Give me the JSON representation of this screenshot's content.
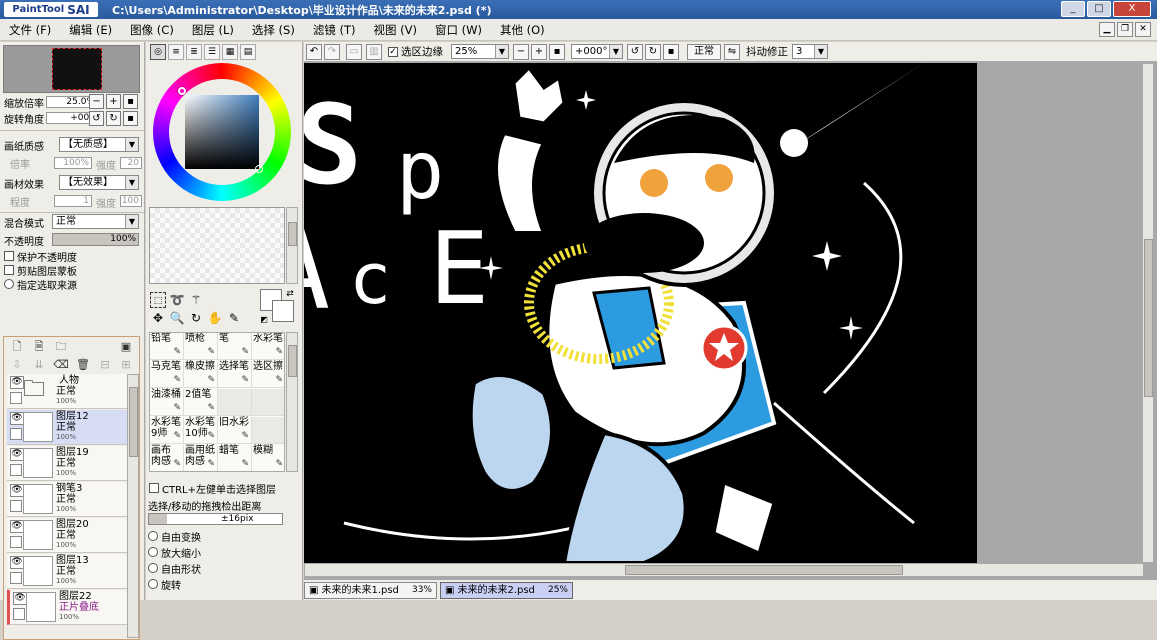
{
  "app": {
    "logo_text": "PaintTool",
    "logo_bold": "SAI",
    "title": "C:\\Users\\Administrator\\Desktop\\毕业设计作品\\未来的未来2.psd (*)",
    "window_buttons": [
      "_",
      "□",
      "X"
    ]
  },
  "menu": [
    "文件 (F)",
    "编辑 (E)",
    "图像 (C)",
    "图层 (L)",
    "选择 (S)",
    "滤镜 (T)",
    "视图 (V)",
    "窗口 (W)",
    "其他 (O)"
  ],
  "navigator": {
    "zoom_label": "缩放倍率",
    "zoom_value": "25.0%",
    "rotate_label": "旋转角度",
    "rotate_value": "+000"
  },
  "texture": {
    "paper_label": "画纸质感",
    "paper_value": "【无质感】",
    "rate_label": "倍率",
    "rate_value": "100%",
    "strength_label": "强度",
    "strength_value": "20",
    "effect_label": "画材效果",
    "effect_value": "【无效果】",
    "degree_label": "程度",
    "degree_value": "1",
    "strength2_label": "强度",
    "strength2_value": "100"
  },
  "layer_props": {
    "blend_label": "混合模式",
    "blend_value": "正常",
    "opacity_label": "不透明度",
    "opacity_value": "100%",
    "preserve_opacity": "保护不透明度",
    "clipping": "剪贴图层蒙板",
    "selection_source": "指定选取来源"
  },
  "layers": [
    {
      "name": "人物",
      "mode": "正常",
      "opacity": "100%",
      "type": "folder",
      "active": false
    },
    {
      "name": "图层12",
      "mode": "正常",
      "opacity": "100%",
      "type": "layer",
      "active": true
    },
    {
      "name": "图层19",
      "mode": "正常",
      "opacity": "100%",
      "type": "layer",
      "active": false
    },
    {
      "name": "钢笔3",
      "mode": "正常",
      "opacity": "100%",
      "type": "layer",
      "active": false
    },
    {
      "name": "图层20",
      "mode": "正常",
      "opacity": "100%",
      "type": "layer",
      "active": false
    },
    {
      "name": "图层13",
      "mode": "正常",
      "opacity": "100%",
      "type": "layer",
      "active": false
    },
    {
      "name": "图层22",
      "mode": "正片叠底",
      "opacity": "100%",
      "type": "layer",
      "active": false
    }
  ],
  "brushes": [
    [
      "铅笔",
      "喷枪",
      "笔",
      "水彩笔"
    ],
    [
      "马克笔",
      "橡皮擦",
      "选择笔",
      "选区擦"
    ],
    [
      "油漆桶",
      "2值笔",
      "",
      ""
    ],
    [
      "水彩笔 9师",
      "水彩笔 10师",
      "旧水彩",
      ""
    ],
    [
      "画布 肉感",
      "画用纸 肉感",
      "蜡笔",
      "模糊"
    ]
  ],
  "tool_options": {
    "ctrl_select": "CTRL+左健单击选择图层",
    "drag_label": "选择/移动的拖拽检出距离",
    "drag_value": "±16pix",
    "transforms": [
      "自由变换",
      "放大缩小",
      "自由形状",
      "旋转"
    ]
  },
  "canvas_toolbar": {
    "selection_edge": "选区边缘",
    "zoom": "25%",
    "rotation": "+000°",
    "blend": "正常",
    "stabilizer_label": "抖动修正",
    "stabilizer_value": "3"
  },
  "artwork_text": "SPACE",
  "tabs": [
    {
      "name": "未来的未来1.psd",
      "zoom": "33%",
      "active": false
    },
    {
      "name": "未来的未来2.psd",
      "zoom": "25%",
      "active": true
    }
  ],
  "colors": {
    "artwork_bg": "#000000",
    "canvas_bg": "#a7a7a7",
    "suit_blue": "#2d9be0",
    "helmet_yellow": "#f2e03a",
    "star_red": "#e23a2e",
    "face_orange": "#f0a33c"
  }
}
